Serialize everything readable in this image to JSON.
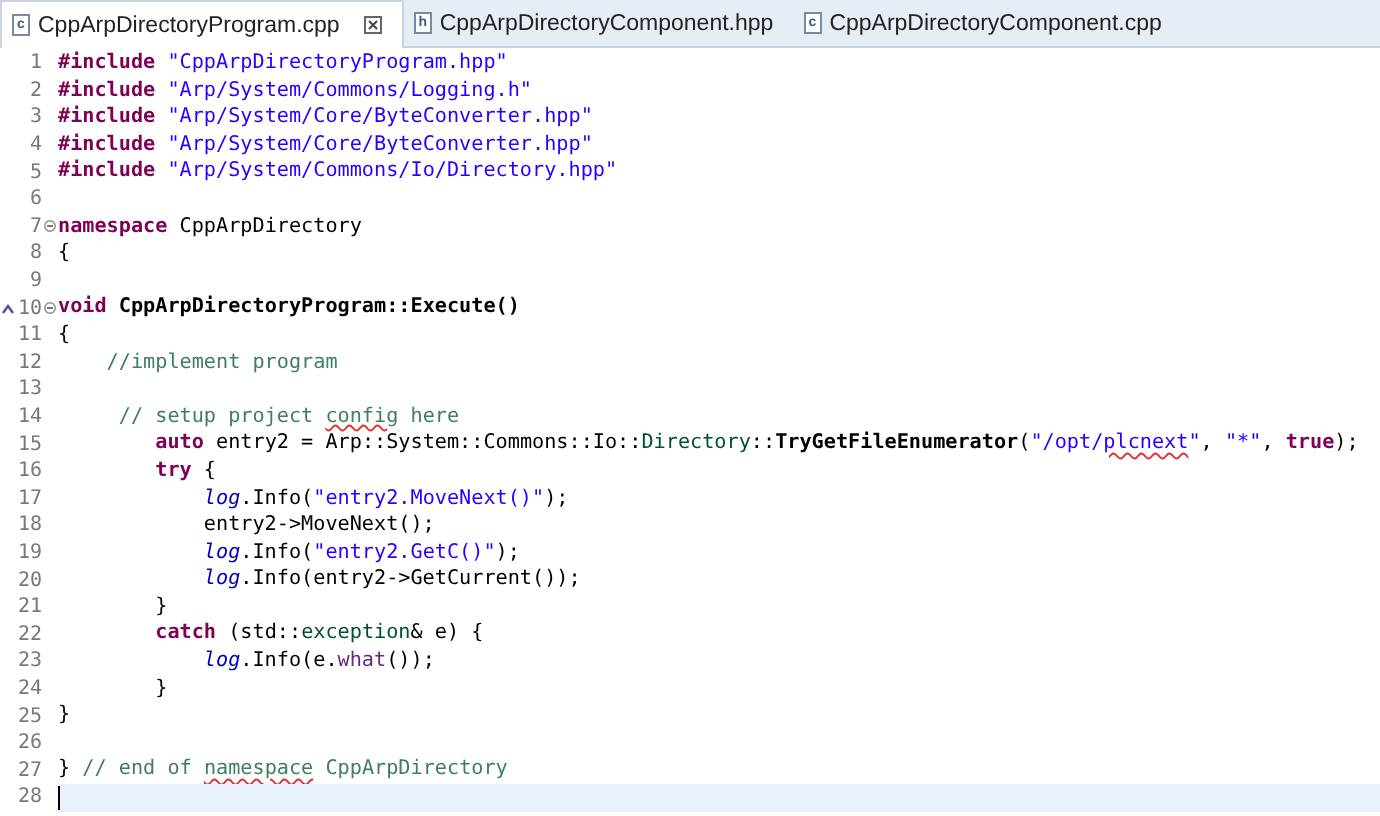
{
  "tabs": [
    {
      "label": "CppArpDirectoryProgram.cpp",
      "badge": "c",
      "selected": true
    },
    {
      "label": "CppArpDirectoryComponent.hpp",
      "badge": "h",
      "selected": false
    },
    {
      "label": "CppArpDirectoryComponent.cpp",
      "badge": "c",
      "selected": false
    }
  ],
  "editor": {
    "lines": [
      {
        "number": "1",
        "folding": false,
        "override": false,
        "current": false,
        "tokens": [
          {
            "kind": "keyword",
            "text": "#include "
          },
          {
            "kind": "string",
            "text": "\"CppArpDirectoryProgram.hpp\""
          }
        ]
      },
      {
        "number": "2",
        "folding": false,
        "override": false,
        "current": false,
        "tokens": [
          {
            "kind": "keyword",
            "text": "#include "
          },
          {
            "kind": "string",
            "text": "\"Arp/System/Commons/Logging.h\""
          }
        ]
      },
      {
        "number": "3",
        "folding": false,
        "override": false,
        "current": false,
        "tokens": [
          {
            "kind": "keyword",
            "text": "#include "
          },
          {
            "kind": "string",
            "text": "\"Arp/System/Core/ByteConverter.hpp\""
          }
        ]
      },
      {
        "number": "4",
        "folding": false,
        "override": false,
        "current": false,
        "tokens": [
          {
            "kind": "keyword",
            "text": "#include "
          },
          {
            "kind": "string",
            "text": "\"Arp/System/Core/ByteConverter.hpp\""
          }
        ]
      },
      {
        "number": "5",
        "folding": false,
        "override": false,
        "current": false,
        "tokens": [
          {
            "kind": "keyword",
            "text": "#include "
          },
          {
            "kind": "string",
            "text": "\"Arp/System/Commons/Io/Directory.hpp\""
          }
        ]
      },
      {
        "number": "6",
        "folding": false,
        "override": false,
        "current": false
      },
      {
        "number": "7",
        "folding": true,
        "override": false,
        "current": false,
        "tokens": [
          {
            "kind": "keyword",
            "text": "namespace"
          },
          {
            "kind": "plain",
            "text": " CppArpDirectory"
          }
        ]
      },
      {
        "number": "8",
        "folding": false,
        "override": false,
        "current": false,
        "tokens": [
          {
            "kind": "plain",
            "text": "{"
          }
        ]
      },
      {
        "number": "9",
        "folding": false,
        "override": false,
        "current": false
      },
      {
        "number": "10",
        "folding": true,
        "override": true,
        "current": false,
        "tokens": [
          {
            "kind": "keyword",
            "text": "void "
          },
          {
            "kind": "function",
            "text": "CppArpDirectoryProgram::Execute()"
          }
        ]
      },
      {
        "number": "11",
        "folding": false,
        "override": false,
        "current": false,
        "tokens": [
          {
            "kind": "plain",
            "text": "{"
          }
        ]
      },
      {
        "number": "12",
        "folding": false,
        "override": false,
        "current": false,
        "tokens": [
          {
            "kind": "comment",
            "text": "    //implement program"
          }
        ]
      },
      {
        "number": "13",
        "folding": false,
        "override": false,
        "current": false
      },
      {
        "number": "14",
        "folding": false,
        "override": false,
        "current": false,
        "tokens": [
          {
            "kind": "comment",
            "text": "     // setup project "
          },
          {
            "kind": "comment-typo",
            "text": "config"
          },
          {
            "kind": "comment",
            "text": " here"
          }
        ]
      },
      {
        "number": "15",
        "folding": false,
        "override": false,
        "current": false,
        "tokens": [
          {
            "kind": "keyword",
            "text": "        auto"
          },
          {
            "kind": "plain",
            "text": " entry2 = Arp::System::Commons::Io::"
          },
          {
            "kind": "type",
            "text": "Directory"
          },
          {
            "kind": "plain",
            "text": "::"
          },
          {
            "kind": "function",
            "text": "TryGetFileEnumerator"
          },
          {
            "kind": "plain",
            "text": "("
          },
          {
            "kind": "string",
            "text": "\"/opt/"
          },
          {
            "kind": "string-typo",
            "text": "plcnext"
          },
          {
            "kind": "string",
            "text": "\""
          },
          {
            "kind": "plain",
            "text": ", "
          },
          {
            "kind": "string",
            "text": "\"*\""
          },
          {
            "kind": "plain",
            "text": ", "
          },
          {
            "kind": "keyword",
            "text": "true"
          },
          {
            "kind": "plain",
            "text": ");"
          }
        ]
      },
      {
        "number": "16",
        "folding": false,
        "override": false,
        "current": false,
        "tokens": [
          {
            "kind": "keyword",
            "text": "        try"
          },
          {
            "kind": "plain",
            "text": " {"
          }
        ]
      },
      {
        "number": "17",
        "folding": false,
        "override": false,
        "current": false,
        "tokens": [
          {
            "kind": "field",
            "text": "            log"
          },
          {
            "kind": "plain",
            "text": ".Info("
          },
          {
            "kind": "string",
            "text": "\"entry2.MoveNext()\""
          },
          {
            "kind": "plain",
            "text": ");"
          }
        ]
      },
      {
        "number": "18",
        "folding": false,
        "override": false,
        "current": false,
        "tokens": [
          {
            "kind": "plain",
            "text": "            entry2->MoveNext();"
          }
        ]
      },
      {
        "number": "19",
        "folding": false,
        "override": false,
        "current": false,
        "tokens": [
          {
            "kind": "field",
            "text": "            log"
          },
          {
            "kind": "plain",
            "text": ".Info("
          },
          {
            "kind": "string",
            "text": "\"entry2.GetC()\""
          },
          {
            "kind": "plain",
            "text": ");"
          }
        ]
      },
      {
        "number": "20",
        "folding": false,
        "override": false,
        "current": false,
        "tokens": [
          {
            "kind": "field",
            "text": "            log"
          },
          {
            "kind": "plain",
            "text": ".Info(entry2->GetCurrent());"
          }
        ]
      },
      {
        "number": "21",
        "folding": false,
        "override": false,
        "current": false,
        "tokens": [
          {
            "kind": "plain",
            "text": "        }"
          }
        ]
      },
      {
        "number": "22",
        "folding": false,
        "override": false,
        "current": false,
        "tokens": [
          {
            "kind": "keyword",
            "text": "        catch"
          },
          {
            "kind": "plain",
            "text": " (std::"
          },
          {
            "kind": "type",
            "text": "exception"
          },
          {
            "kind": "plain",
            "text": "& e) {"
          }
        ]
      },
      {
        "number": "23",
        "folding": false,
        "override": false,
        "current": false,
        "tokens": [
          {
            "kind": "field",
            "text": "            log"
          },
          {
            "kind": "plain",
            "text": ".Info(e."
          },
          {
            "kind": "method",
            "text": "what"
          },
          {
            "kind": "plain",
            "text": "());"
          }
        ]
      },
      {
        "number": "24",
        "folding": false,
        "override": false,
        "current": false,
        "tokens": [
          {
            "kind": "plain",
            "text": "        }"
          }
        ]
      },
      {
        "number": "25",
        "folding": false,
        "override": false,
        "current": false,
        "tokens": [
          {
            "kind": "plain",
            "text": "}"
          }
        ]
      },
      {
        "number": "26",
        "folding": false,
        "override": false,
        "current": false
      },
      {
        "number": "27",
        "folding": false,
        "override": false,
        "current": false,
        "tokens": [
          {
            "kind": "plain",
            "text": "} "
          },
          {
            "kind": "comment",
            "text": "// end of "
          },
          {
            "kind": "comment-typo",
            "text": "namespace"
          },
          {
            "kind": "comment",
            "text": " CppArpDirectory"
          }
        ]
      },
      {
        "number": "28",
        "folding": false,
        "override": false,
        "current": true
      }
    ]
  }
}
